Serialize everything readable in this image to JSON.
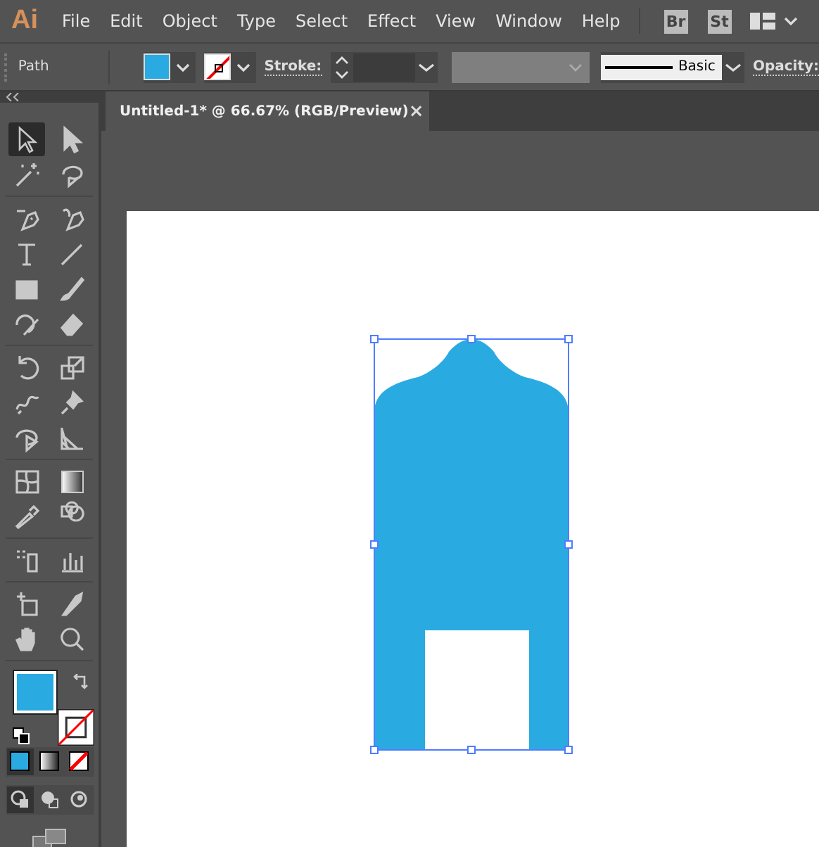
{
  "app_logo": "Ai",
  "menu": [
    "File",
    "Edit",
    "Object",
    "Type",
    "Select",
    "Effect",
    "View",
    "Window",
    "Help"
  ],
  "bridge_buttons": [
    "Br",
    "St"
  ],
  "control_bar": {
    "selection_label": "Path",
    "stroke_label": "Stroke:",
    "brush": "Basic",
    "opacity_label": "Opacity:"
  },
  "document_tab": {
    "title": "Untitled-1* @ 66.67% (RGB/Preview)",
    "close": "×"
  },
  "tool_groups": [
    [
      {
        "kind": "selection",
        "selected": true
      },
      {
        "kind": "direct-selection",
        "selected": false
      },
      {
        "kind": "magic-wand",
        "selected": false
      },
      {
        "kind": "lasso",
        "selected": false
      }
    ],
    [
      {
        "kind": "pen",
        "selected": false
      },
      {
        "kind": "curvature",
        "selected": false
      },
      {
        "kind": "type",
        "selected": false
      },
      {
        "kind": "line",
        "selected": false
      },
      {
        "kind": "rectangle",
        "selected": false
      },
      {
        "kind": "paintbrush",
        "selected": false
      },
      {
        "kind": "shaper",
        "selected": false
      },
      {
        "kind": "eraser",
        "selected": false
      }
    ],
    [
      {
        "kind": "rotate",
        "selected": false
      },
      {
        "kind": "scale",
        "selected": false
      },
      {
        "kind": "warp",
        "selected": false
      },
      {
        "kind": "pin",
        "selected": false
      },
      {
        "kind": "shape-builder",
        "selected": false
      },
      {
        "kind": "perspective",
        "selected": false
      }
    ],
    [
      {
        "kind": "mesh",
        "selected": false
      },
      {
        "kind": "gradient",
        "selected": false
      },
      {
        "kind": "eyedropper",
        "selected": false
      },
      {
        "kind": "blend",
        "selected": false
      }
    ],
    [
      {
        "kind": "sprayer",
        "selected": false
      },
      {
        "kind": "graph",
        "selected": false
      }
    ],
    [
      {
        "kind": "artboard",
        "selected": false
      },
      {
        "kind": "knife",
        "selected": false
      },
      {
        "kind": "hand",
        "selected": false
      },
      {
        "kind": "zoom",
        "selected": false
      }
    ]
  ],
  "color_modes": [
    {
      "kind": "color",
      "selected": true
    },
    {
      "kind": "gradient",
      "selected": false
    },
    {
      "kind": "none",
      "selected": false
    }
  ],
  "draw_modes": [
    {
      "kind": "normal",
      "selected": true
    },
    {
      "kind": "behind",
      "selected": false
    },
    {
      "kind": "inside",
      "selected": false
    }
  ]
}
